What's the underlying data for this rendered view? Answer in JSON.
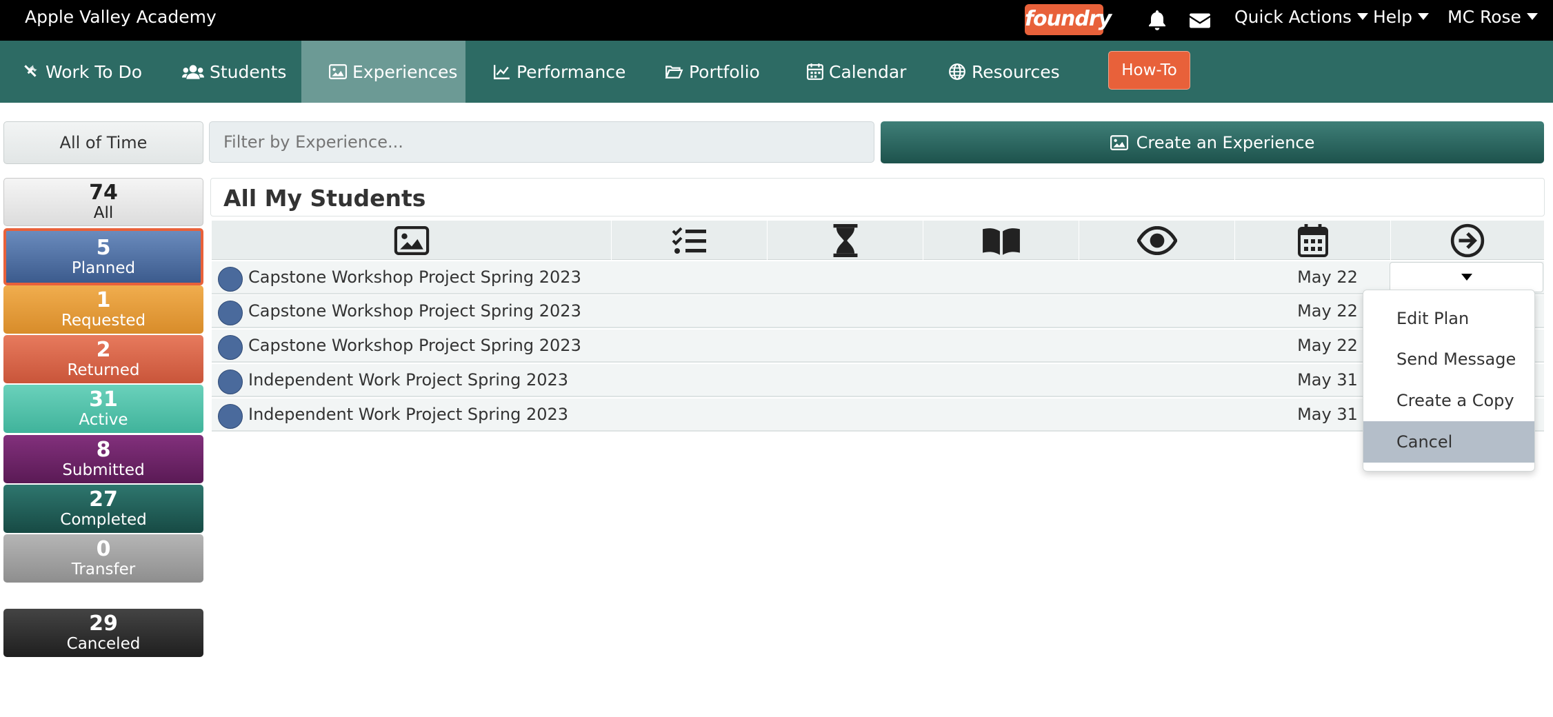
{
  "topbar": {
    "school_name": "Apple Valley Academy",
    "logo_text": "foundry",
    "quick_actions": "Quick Actions",
    "help": "Help",
    "user": "MC Rose",
    "icons": [
      "bell-icon",
      "envelope-icon"
    ]
  },
  "nav": {
    "items": [
      {
        "label": "Work To Do",
        "icon": "tools-icon"
      },
      {
        "label": "Students",
        "icon": "users-icon"
      },
      {
        "label": "Experiences",
        "icon": "image-icon",
        "active": true
      },
      {
        "label": "Performance",
        "icon": "chart-line-icon"
      },
      {
        "label": "Portfolio",
        "icon": "folder-open-icon"
      },
      {
        "label": "Calendar",
        "icon": "calendar-icon"
      },
      {
        "label": "Resources",
        "icon": "globe-icon"
      }
    ],
    "howto": "How-To"
  },
  "toolbar": {
    "time_filter": "All of Time",
    "filter_placeholder": "Filter by Experience...",
    "create_label": "Create an Experience"
  },
  "statuses": [
    {
      "count": "74",
      "label": "All",
      "color": "#e6e6e6"
    },
    {
      "count": "5",
      "label": "Planned",
      "color": "#4b6c9e",
      "selected": true
    },
    {
      "count": "1",
      "label": "Requested",
      "color": "#e79b35"
    },
    {
      "count": "2",
      "label": "Returned",
      "color": "#d9664a"
    },
    {
      "count": "31",
      "label": "Active",
      "color": "#4fbfa8"
    },
    {
      "count": "8",
      "label": "Submitted",
      "color": "#6b2266"
    },
    {
      "count": "27",
      "label": "Completed",
      "color": "#215e57"
    },
    {
      "count": "0",
      "label": "Transfer",
      "color": "#9e9e9e"
    },
    {
      "count": "29",
      "label": "Canceled",
      "color": "#2b2b2b"
    }
  ],
  "panel": {
    "title": "All My Students",
    "columns": [
      "image-icon",
      "tasks-icon",
      "hourglass-icon",
      "book-open-icon",
      "eye-icon",
      "calendar-icon",
      "arrow-circle-right-icon"
    ],
    "rows": [
      {
        "title": "Capstone Workshop Project Spring 2023",
        "date": "May 22"
      },
      {
        "title": "Capstone Workshop Project Spring 2023",
        "date": "May 22"
      },
      {
        "title": "Capstone Workshop Project Spring 2023",
        "date": "May 22"
      },
      {
        "title": "Independent Work Project Spring 2023",
        "date": "May 31"
      },
      {
        "title": "Independent Work Project Spring 2023",
        "date": "May 31"
      }
    ]
  },
  "menu": {
    "items": [
      "Edit Plan",
      "Send Message",
      "Create a Copy",
      "Cancel"
    ],
    "highlighted": "Cancel"
  }
}
